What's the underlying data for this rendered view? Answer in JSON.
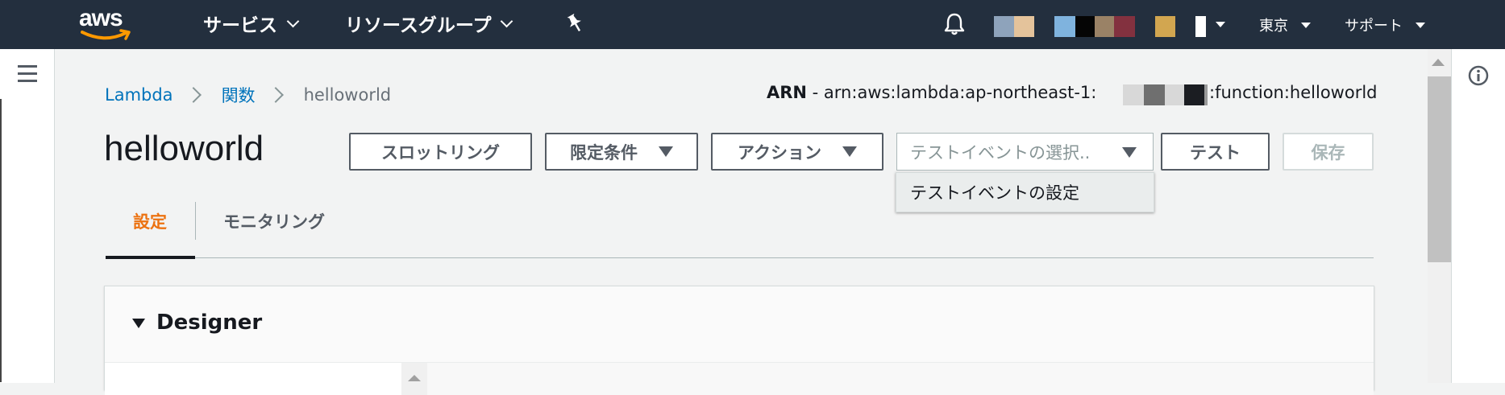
{
  "topnav": {
    "logo_text": "aws",
    "services": "サービス",
    "resource_groups": "リソースグループ",
    "region": "東京",
    "support": "サポート",
    "account_swatches": [
      "#8ea3bb",
      "#e4c39b",
      "#7fb3de",
      "#050505",
      "#9a8266",
      "#83313f",
      "#d2a650",
      "#ffffff"
    ]
  },
  "breadcrumb": {
    "items": [
      "Lambda",
      "関数"
    ],
    "current": "helloworld"
  },
  "arn": {
    "label": "ARN",
    "prefix": " - arn:aws:lambda:ap-northeast-1:",
    "suffix": ":function:helloworld",
    "mask_colors": [
      "#d8d8d8",
      "#6f6f6f",
      "#9a9a9a",
      "#1b1d22"
    ]
  },
  "function": {
    "name": "helloworld"
  },
  "toolbar": {
    "throttling": "スロットリング",
    "qualifiers": "限定条件",
    "actions": "アクション",
    "test_event_placeholder": "テストイベントの選択..",
    "test": "テスト",
    "save": "保存"
  },
  "dropdown": {
    "items": [
      "テストイベントの設定"
    ]
  },
  "tabs": [
    {
      "label": "設定",
      "active": true
    },
    {
      "label": "モニタリング",
      "active": false
    }
  ],
  "designer": {
    "title": "Designer"
  },
  "colors": {
    "nav_bg": "#232f3e",
    "link": "#0073bb",
    "active_tab": "#ec7211",
    "aws_smile": "#ff9900"
  }
}
